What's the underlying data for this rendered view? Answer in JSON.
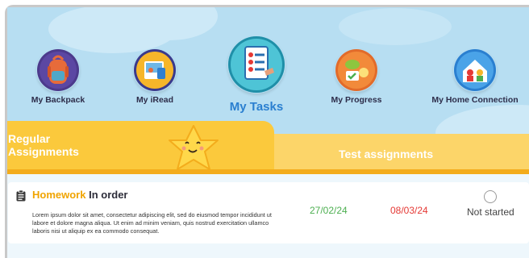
{
  "nav": {
    "items": [
      {
        "label": "My Backpack",
        "icon": "backpack-icon"
      },
      {
        "label": "My iRead",
        "icon": "book-icon"
      },
      {
        "label": "My Tasks",
        "icon": "task-list-icon",
        "active": true
      },
      {
        "label": "My Progress",
        "icon": "progress-badge-icon"
      },
      {
        "label": "My Home Connection",
        "icon": "home-family-icon"
      }
    ]
  },
  "tabs": {
    "regular_label": "Regular Assignments",
    "test_label": "Test assignments"
  },
  "task": {
    "kind": "Homework",
    "title": "In order",
    "description": "Lorem ipsum dolor sit amet, consectetur adipiscing elit, sed do eiusmod tempor incididunt ut labore et dolore magna aliqua. Ut enim ad minim veniam, quis nostrud exercitation ullamco laboris nisi ut aliquip ex ea commodo consequat.",
    "start_date": "27/02/24",
    "due_date": "08/03/24",
    "status": "Not started"
  },
  "colors": {
    "sky": "#b7def2",
    "tab_active": "#fbc93c",
    "tab_inactive": "#fcd569",
    "accent_orange": "#f0a400",
    "start_green": "#4caf50",
    "due_red": "#e53935"
  }
}
